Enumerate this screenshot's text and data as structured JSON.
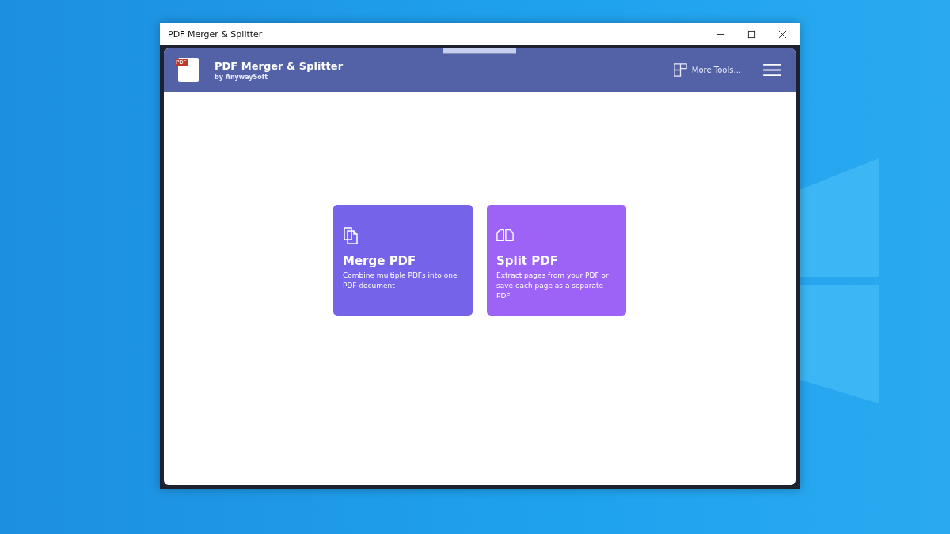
{
  "window": {
    "title": "PDF Merger & Splitter"
  },
  "header": {
    "logo_text": "PDF",
    "app_name": "PDF Merger & Splitter",
    "publisher": "by AnywaySoft",
    "more_tools": "More Tools..."
  },
  "cards": [
    {
      "kind": "merge",
      "title": "Merge PDF",
      "description": "Combine multiple PDFs into one PDF document",
      "color": "#7563ea"
    },
    {
      "kind": "split",
      "title": "Split PDF",
      "description": "Extract pages from your PDF or save each page as a separate PDF",
      "color": "#9d63f6"
    }
  ]
}
